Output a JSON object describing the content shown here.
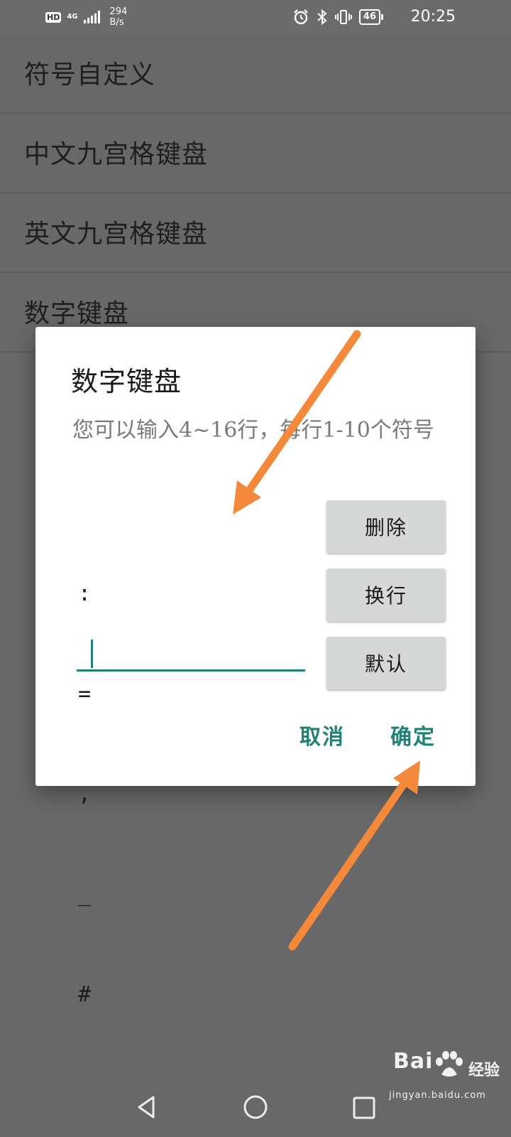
{
  "status_bar": {
    "hd_label": "HD",
    "network_type": "4G",
    "net_speed_value": "294",
    "net_speed_unit": "B/s",
    "icons": [
      "alarm-icon",
      "bluetooth-icon",
      "vibrate-icon",
      "battery-icon"
    ],
    "battery_level": "46",
    "time": "20:25"
  },
  "settings_list": {
    "items": [
      {
        "label": "符号自定义"
      },
      {
        "label": "中文九宫格键盘"
      },
      {
        "label": "英文九宫格键盘"
      },
      {
        "label": "数字键盘"
      }
    ]
  },
  "dialog": {
    "title": "数字键盘",
    "message": "您可以输入4~16行，每行1-10个符号",
    "input_lines": [
      ":",
      "=",
      ",",
      "_",
      "#"
    ],
    "side_buttons": {
      "delete": "删除",
      "newline": "换行",
      "default": "默认"
    },
    "actions": {
      "cancel": "取消",
      "confirm": "确定"
    }
  },
  "overlay": {
    "arrow_color": "#f5893b"
  },
  "nav_bar": {
    "icons": [
      "back-icon",
      "home-icon",
      "recent-apps-icon"
    ]
  },
  "watermark": {
    "brand": "Bai",
    "brand_suffix": "经验",
    "url": "jingyan.baidu.com"
  },
  "colors": {
    "accent": "#1f8277",
    "dim_background": "#686868",
    "button_gray": "#d6d7d7"
  }
}
